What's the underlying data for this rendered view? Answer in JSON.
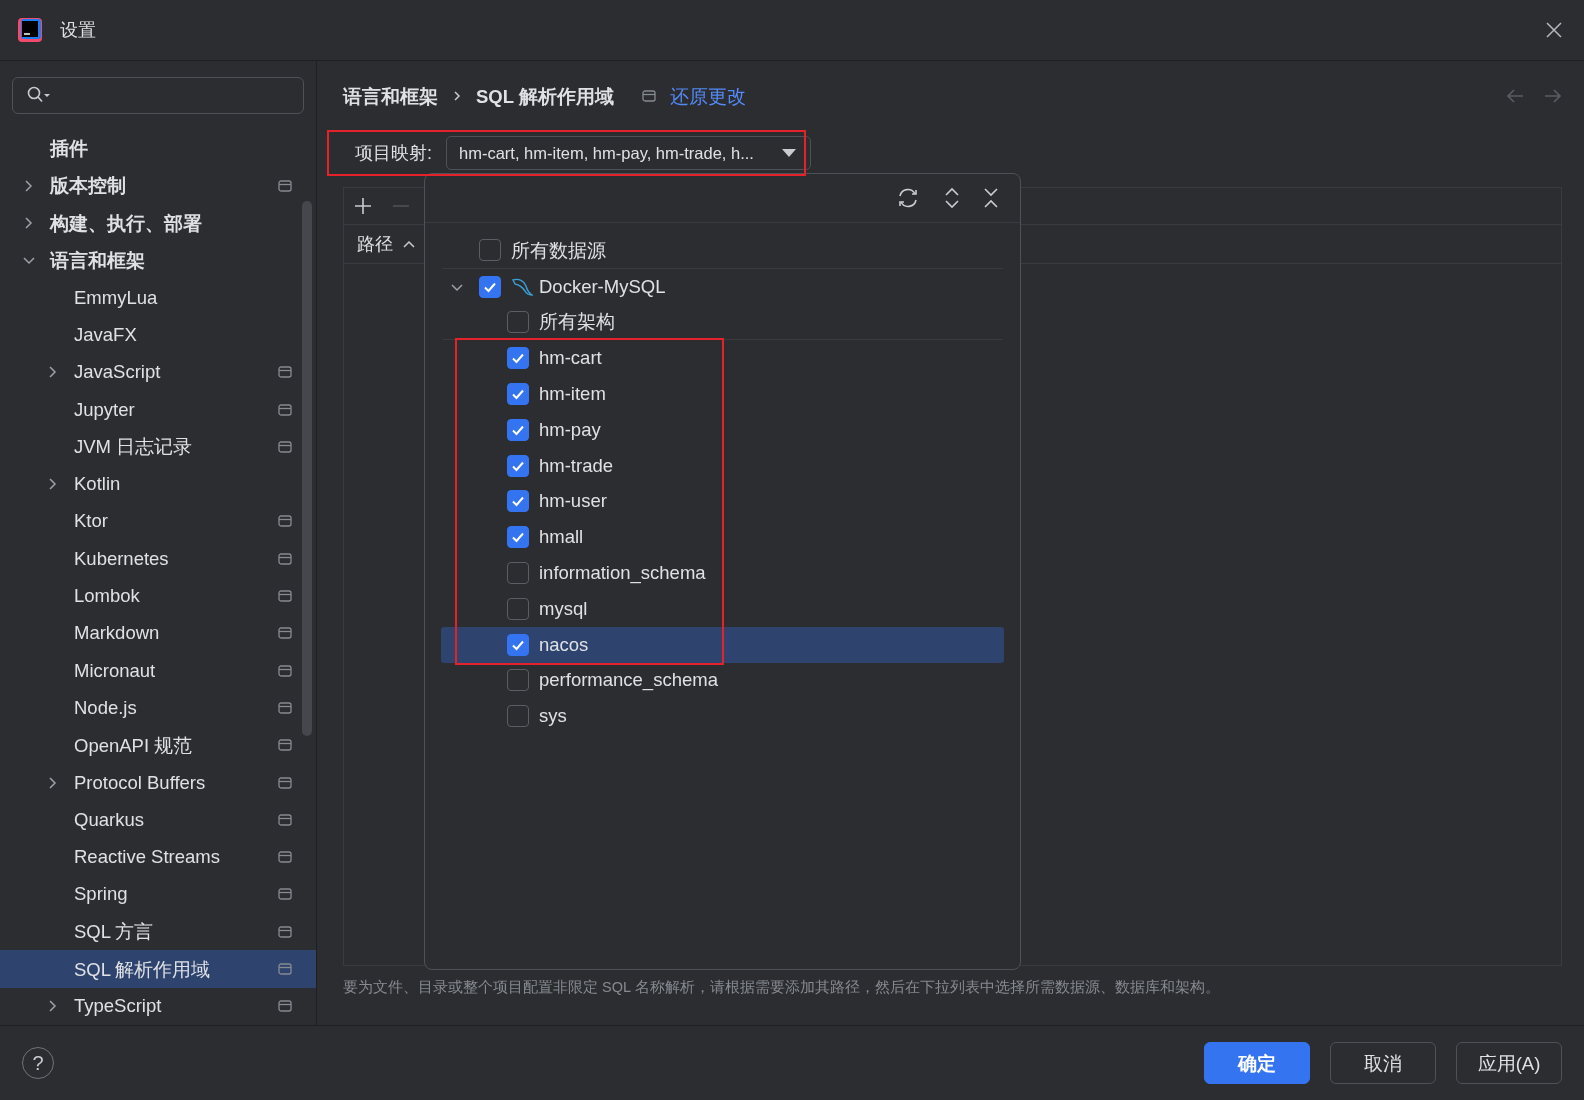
{
  "window": {
    "title": "设置"
  },
  "sidebar": {
    "items": [
      {
        "label": "插件",
        "project_icon": false,
        "selected": false
      },
      {
        "label": "版本控制",
        "expanded": false,
        "project_icon": true,
        "selected": false
      },
      {
        "label": "构建、执行、部署",
        "expanded": false,
        "project_icon": false,
        "selected": false
      },
      {
        "label": "语言和框架",
        "expanded": true,
        "project_icon": false,
        "selected": false,
        "children": [
          {
            "label": "EmmyLua",
            "project_icon": false,
            "selected": false
          },
          {
            "label": "JavaFX",
            "project_icon": false,
            "selected": false
          },
          {
            "label": "JavaScript",
            "expanded": false,
            "project_icon": true,
            "selected": false
          },
          {
            "label": "Jupyter",
            "project_icon": true,
            "selected": false
          },
          {
            "label": "JVM 日志记录",
            "project_icon": true,
            "selected": false
          },
          {
            "label": "Kotlin",
            "expanded": false,
            "project_icon": false,
            "selected": false
          },
          {
            "label": "Ktor",
            "project_icon": true,
            "selected": false
          },
          {
            "label": "Kubernetes",
            "project_icon": true,
            "selected": false
          },
          {
            "label": "Lombok",
            "project_icon": true,
            "selected": false
          },
          {
            "label": "Markdown",
            "project_icon": true,
            "selected": false
          },
          {
            "label": "Micronaut",
            "project_icon": true,
            "selected": false
          },
          {
            "label": "Node.js",
            "project_icon": true,
            "selected": false
          },
          {
            "label": "OpenAPI 规范",
            "project_icon": true,
            "selected": false
          },
          {
            "label": "Protocol Buffers",
            "expanded": false,
            "project_icon": true,
            "selected": false
          },
          {
            "label": "Quarkus",
            "project_icon": true,
            "selected": false
          },
          {
            "label": "Reactive Streams",
            "project_icon": true,
            "selected": false
          },
          {
            "label": "Spring",
            "project_icon": true,
            "selected": false
          },
          {
            "label": "SQL 方言",
            "project_icon": true,
            "selected": false
          },
          {
            "label": "SQL 解析作用域",
            "project_icon": true,
            "selected": true
          },
          {
            "label": "TypeScript",
            "expanded": false,
            "project_icon": true,
            "selected": false
          }
        ]
      }
    ]
  },
  "breadcrumb": {
    "items": [
      "语言和框架",
      "SQL 解析作用域"
    ],
    "reset_link": "还原更改"
  },
  "nav": [
    {
      "kind": "back",
      "disabled": true
    },
    {
      "kind": "forward",
      "disabled": true
    }
  ],
  "mapping": {
    "label": "项目映射:",
    "value": "hm-cart, hm-item, hm-pay, hm-trade, h..."
  },
  "toolbar": [
    {
      "kind": "add",
      "disabled": false
    },
    {
      "kind": "remove",
      "disabled": true
    }
  ],
  "table": {
    "columns": [
      {
        "label": "路径",
        "ascending": true
      }
    ]
  },
  "popup": {
    "tree": [
      {
        "kind": "all",
        "label": "所有数据源",
        "checked": false,
        "selected": false
      },
      {
        "kind": "datasource",
        "label": "Docker-MySQL",
        "checked": true,
        "expanded": true,
        "selected": false,
        "children": [
          {
            "kind": "all",
            "label": "所有架构",
            "checked": false,
            "selected": false
          },
          {
            "kind": "schema",
            "label": "hm-cart",
            "checked": true,
            "selected": false
          },
          {
            "kind": "schema",
            "label": "hm-item",
            "checked": true,
            "selected": false
          },
          {
            "kind": "schema",
            "label": "hm-pay",
            "checked": true,
            "selected": false
          },
          {
            "kind": "schema",
            "label": "hm-trade",
            "checked": true,
            "selected": false
          },
          {
            "kind": "schema",
            "label": "hm-user",
            "checked": true,
            "selected": false
          },
          {
            "kind": "schema",
            "label": "hmall",
            "checked": true,
            "selected": false
          },
          {
            "kind": "schema",
            "label": "information_schema",
            "checked": false,
            "selected": false
          },
          {
            "kind": "schema",
            "label": "mysql",
            "checked": false,
            "selected": false
          },
          {
            "kind": "schema",
            "label": "nacos",
            "checked": true,
            "selected": true
          },
          {
            "kind": "schema",
            "label": "performance_schema",
            "checked": false,
            "selected": false
          },
          {
            "kind": "schema",
            "label": "sys",
            "checked": false,
            "selected": false
          }
        ]
      }
    ]
  },
  "hint": "要为文件、目录或整个项目配置非限定 SQL 名称解析，请根据需要添加其路径，然后在下拉列表中选择所需数据源、数据库和架构。",
  "help": "?",
  "buttons": [
    {
      "label": "确定",
      "primary": true
    },
    {
      "label": "取消",
      "primary": false
    },
    {
      "label": "应用(A)",
      "primary": false
    }
  ]
}
